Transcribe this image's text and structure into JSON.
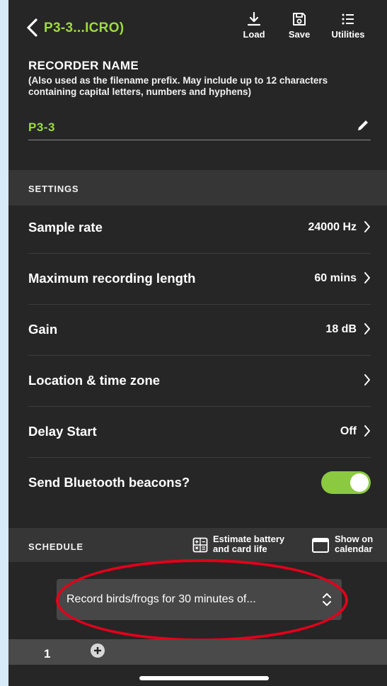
{
  "header": {
    "title": "P3-3...ICRO)",
    "tools": [
      {
        "label": "Load",
        "icon": "download-icon"
      },
      {
        "label": "Save",
        "icon": "save-icon"
      },
      {
        "label": "Utilities",
        "icon": "list-icon"
      }
    ]
  },
  "recorder_name": {
    "heading": "RECORDER NAME",
    "help": "(Also used as the filename prefix. May include up to 12 characters containing capital letters, numbers and hyphens)",
    "value": "P3-3"
  },
  "settings": {
    "heading": "SETTINGS",
    "rows": [
      {
        "label": "Sample rate",
        "value": "24000 Hz"
      },
      {
        "label": "Maximum recording length",
        "value": "60 mins"
      },
      {
        "label": "Gain",
        "value": "18 dB"
      },
      {
        "label": "Location & time zone",
        "value": ""
      },
      {
        "label": "Delay Start",
        "value": "Off"
      }
    ],
    "bluetooth": {
      "label": "Send Bluetooth beacons?",
      "enabled": true
    }
  },
  "schedule": {
    "heading": "SCHEDULE",
    "estimate_line1": "Estimate battery",
    "estimate_line2": "and card life",
    "calendar_line1": "Show on",
    "calendar_line2": "calendar",
    "selected": "Record birds/frogs for 30 minutes of...",
    "period_number": "1"
  },
  "colors": {
    "accent_green": "#9cdb3f",
    "toggle_green": "#8bc940",
    "highlight_red": "#e2001a",
    "background": "#262626"
  }
}
